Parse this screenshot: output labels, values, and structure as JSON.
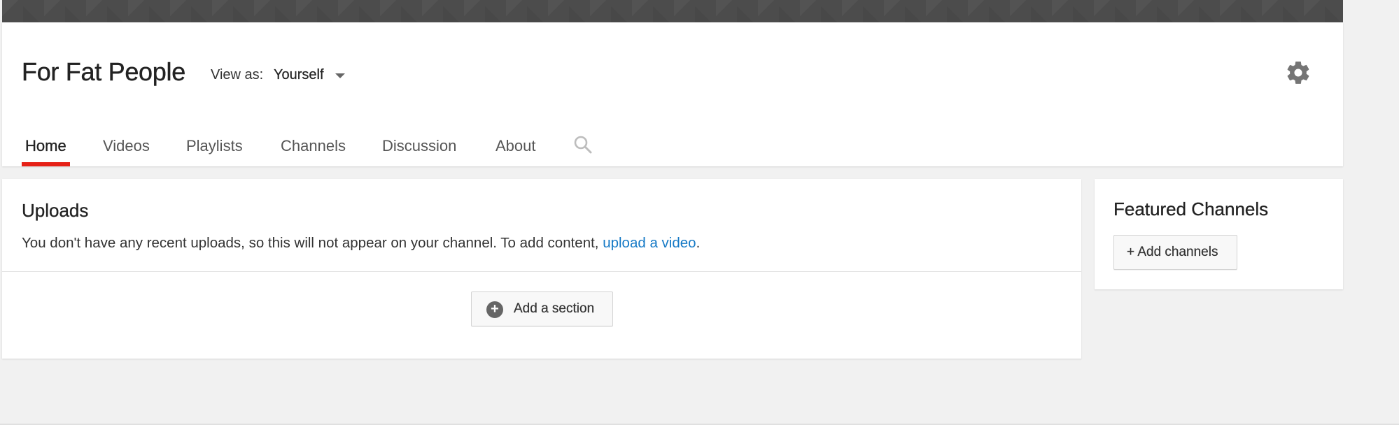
{
  "channel": {
    "title": "For Fat People",
    "view_as_label": "View as:",
    "view_as_value": "Yourself"
  },
  "tabs": [
    {
      "label": "Home",
      "active": true
    },
    {
      "label": "Videos",
      "active": false
    },
    {
      "label": "Playlists",
      "active": false
    },
    {
      "label": "Channels",
      "active": false
    },
    {
      "label": "Discussion",
      "active": false
    },
    {
      "label": "About",
      "active": false
    }
  ],
  "uploads": {
    "title": "Uploads",
    "description": "You don't have any recent uploads, so this will not appear on your channel. To add content, ",
    "link_text": "upload a video",
    "trailing": "."
  },
  "add_section": {
    "label": "Add a section"
  },
  "featured": {
    "title": "Featured Channels",
    "add_label": "+ Add channels"
  },
  "icons": {
    "settings": "gear-icon",
    "search": "search-icon",
    "dropdown": "caret-down-icon",
    "add": "plus-circle-icon"
  },
  "colors": {
    "active_tab_underline": "#e62117",
    "link": "#167ac6",
    "banner": "#4c4c4c"
  }
}
